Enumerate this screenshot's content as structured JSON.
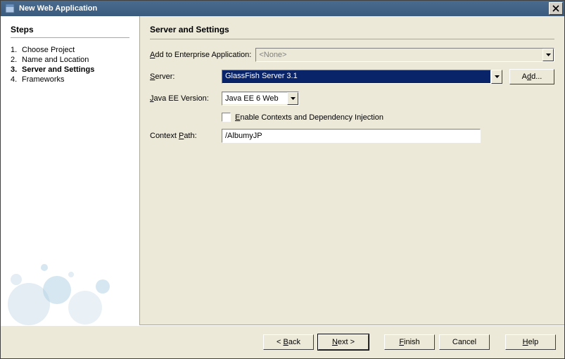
{
  "window": {
    "title": "New Web Application"
  },
  "sidebar": {
    "heading": "Steps",
    "steps": [
      {
        "num": "1.",
        "label": "Choose Project"
      },
      {
        "num": "2.",
        "label": "Name and Location"
      },
      {
        "num": "3.",
        "label": "Server and Settings"
      },
      {
        "num": "4.",
        "label": "Frameworks"
      }
    ],
    "currentIndex": 2
  },
  "main": {
    "heading": "Server and Settings",
    "enterprise_label": "Add to Enterprise Application:",
    "enterprise_value": "<None>",
    "server_label": "Server:",
    "server_value": "GlassFish Server 3.1",
    "add_button": "Add...",
    "jee_label": "Java EE Version:",
    "jee_value": "Java EE 6 Web",
    "cdi_label": "Enable Contexts and Dependency Injection",
    "context_label": "Context Path:",
    "context_value": "/AlbumyJP"
  },
  "footer": {
    "back": "< Back",
    "next": "Next >",
    "finish": "Finish",
    "cancel": "Cancel",
    "help": "Help"
  }
}
